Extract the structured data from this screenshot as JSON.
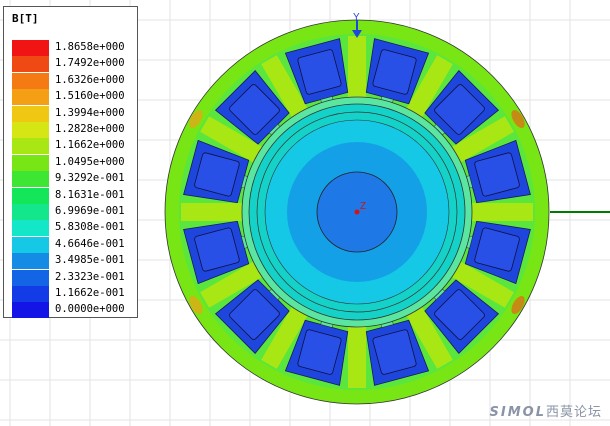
{
  "legend": {
    "title": "B[T]",
    "entries": [
      {
        "value": "1.8658e+000",
        "color": "#f01414"
      },
      {
        "value": "1.7492e+000",
        "color": "#f04a14"
      },
      {
        "value": "1.6326e+000",
        "color": "#f57a14"
      },
      {
        "value": "1.5160e+000",
        "color": "#f5a014"
      },
      {
        "value": "1.3994e+000",
        "color": "#f0c814"
      },
      {
        "value": "1.2828e+000",
        "color": "#d6e614"
      },
      {
        "value": "1.1662e+000",
        "color": "#a8e614"
      },
      {
        "value": "1.0495e+000",
        "color": "#78e614"
      },
      {
        "value": "9.3292e-001",
        "color": "#3ce632"
      },
      {
        "value": "8.1631e-001",
        "color": "#14e65a"
      },
      {
        "value": "6.9969e-001",
        "color": "#14e68c"
      },
      {
        "value": "5.8308e-001",
        "color": "#14e6c8"
      },
      {
        "value": "4.6646e-001",
        "color": "#14c8e6"
      },
      {
        "value": "3.4985e-001",
        "color": "#148ce6"
      },
      {
        "value": "2.3323e-001",
        "color": "#1464e6"
      },
      {
        "value": "1.1662e-001",
        "color": "#143ce6"
      },
      {
        "value": "0.0000e+000",
        "color": "#1414e6"
      }
    ]
  },
  "axis": {
    "y_label": "Y",
    "z_label": "Z"
  },
  "watermark": {
    "brand": "SIMOL",
    "suffix": "西莫论坛"
  },
  "colors": {
    "stator_yoke": "#78e614",
    "teeth": "#a8e614",
    "slot": "#1e46dc",
    "rotor": "#14c8e6",
    "shaft": "#1e78e6",
    "axis_line": "#007a00"
  }
}
